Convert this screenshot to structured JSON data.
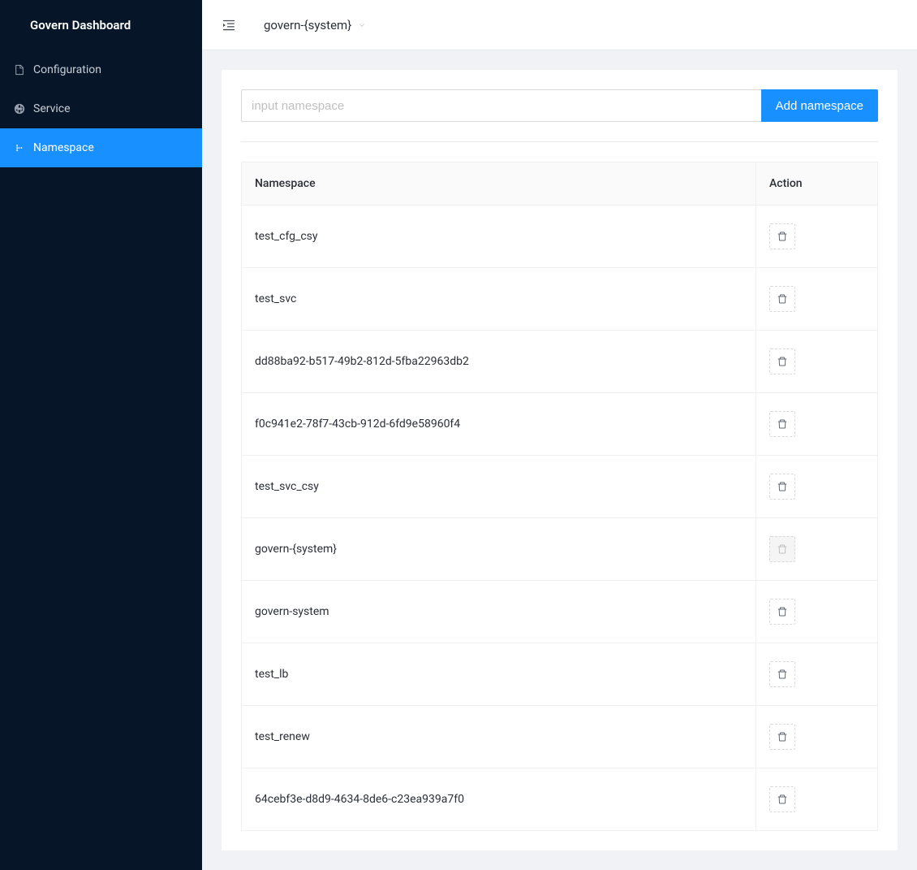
{
  "sidebar": {
    "title": "Govern Dashboard",
    "items": [
      {
        "label": "Configuration",
        "icon": "file-icon",
        "active": false
      },
      {
        "label": "Service",
        "icon": "globe-icon",
        "active": false
      },
      {
        "label": "Namespace",
        "icon": "namespace-icon",
        "active": true
      }
    ]
  },
  "topbar": {
    "selected_namespace": "govern-{system}"
  },
  "namespace_form": {
    "placeholder": "input namespace",
    "value": "",
    "add_label": "Add namespace"
  },
  "table": {
    "columns": {
      "namespace": "Namespace",
      "action": "Action"
    },
    "rows": [
      {
        "name": "test_cfg_csy",
        "delete_disabled": false
      },
      {
        "name": "test_svc",
        "delete_disabled": false
      },
      {
        "name": "dd88ba92-b517-49b2-812d-5fba22963db2",
        "delete_disabled": false
      },
      {
        "name": "f0c941e2-78f7-43cb-912d-6fd9e58960f4",
        "delete_disabled": false
      },
      {
        "name": "test_svc_csy",
        "delete_disabled": false
      },
      {
        "name": "govern-{system}",
        "delete_disabled": true
      },
      {
        "name": "govern-system",
        "delete_disabled": false
      },
      {
        "name": "test_lb",
        "delete_disabled": false
      },
      {
        "name": "test_renew",
        "delete_disabled": false
      },
      {
        "name": "64cebf3e-d8d9-4634-8de6-c23ea939a7f0",
        "delete_disabled": false
      }
    ]
  }
}
